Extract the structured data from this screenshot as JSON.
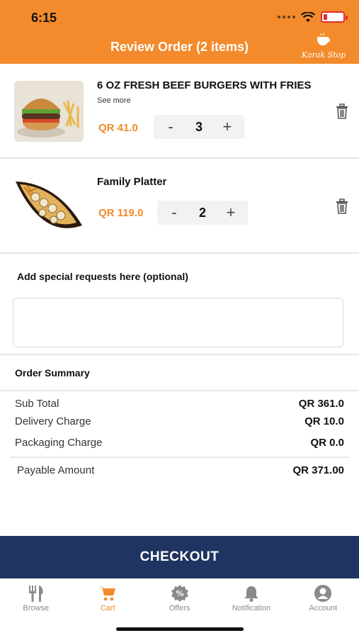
{
  "status_bar": {
    "time": "6:15"
  },
  "header": {
    "title": "Review Order (2 items)",
    "logo_text": "Karak Stop"
  },
  "cart": {
    "items": [
      {
        "name": "6 OZ FRESH BEEF BURGERS WITH FRIES",
        "see_more": "See more",
        "price": "QR 41.0",
        "qty": "3",
        "minus": "-",
        "plus": "+"
      },
      {
        "name": "Family Platter",
        "price": "QR 119.0",
        "qty": "2",
        "minus": "-",
        "plus": "+"
      }
    ]
  },
  "special_requests": {
    "label": "Add special requests here (optional)",
    "value": "",
    "placeholder": ""
  },
  "summary": {
    "title": "Order Summary",
    "sub_total": {
      "label": "Sub Total",
      "value": "QR 361.0"
    },
    "delivery": {
      "label": "Delivery Charge",
      "value": "QR 10.0"
    },
    "packaging": {
      "label": "Packaging Charge",
      "value": "QR 0.0"
    },
    "payable": {
      "label": "Payable Amount",
      "value": "QR 371.00"
    }
  },
  "checkout": {
    "label": "CHECKOUT"
  },
  "tabbar": {
    "tabs": [
      {
        "label": "Browse",
        "icon": "fork-knife-icon"
      },
      {
        "label": "Cart",
        "icon": "cart-icon"
      },
      {
        "label": "Offers",
        "icon": "offer-badge-icon"
      },
      {
        "label": "Notification",
        "icon": "bell-icon"
      },
      {
        "label": "Account",
        "icon": "user-icon"
      }
    ],
    "active": "Cart"
  },
  "colors": {
    "brand_orange": "#F38A2B",
    "checkout_navy": "#1f3461",
    "inactive_gray": "#8a8a8a"
  }
}
